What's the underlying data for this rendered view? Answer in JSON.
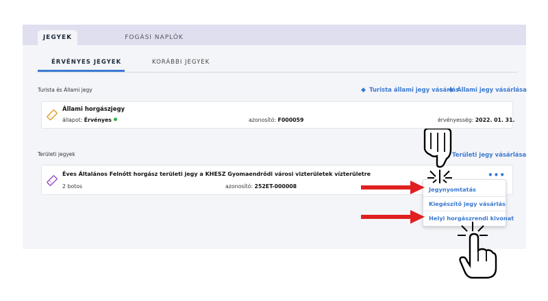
{
  "top_tabs": [
    "JEGYEK",
    "FOGÁSI NAPLÓK"
  ],
  "sub_tabs": [
    "ÉRVÉNYES JEGYEK",
    "KORÁBBI JEGYEK"
  ],
  "section1": {
    "label": "Turista és Állami jegy",
    "links": [
      "Turista állami jegy vásárlás",
      "Állami jegy vásárlása"
    ]
  },
  "card1": {
    "title": "Állami horgászjegy",
    "status_label": "állapot:",
    "status_value": "Érvényes",
    "id_label": "azonosító:",
    "id_value": "F000059",
    "valid_label": "érvényesség:",
    "valid_value": "2022. 01. 31."
  },
  "section2": {
    "label": "Területi jegyek",
    "link": "Területi jegy vásárlása"
  },
  "card2": {
    "title": "Éves Általános Felnőtt horgász területi jegy a KHESZ Gyomaendrődi városi vizterületek vízterületre",
    "sub": "2 botos",
    "id_label": "azonosító:",
    "id_value": "252ET-000008",
    "more": "•••"
  },
  "dropdown": [
    "Jegynyomtatás",
    "Kiegészítő jegy vásárlás",
    "Helyi horgászrendi kivonat"
  ],
  "colors": {
    "accent": "#3b7ad1",
    "arrow": "#e02020",
    "valid_dot": "#2eb04a",
    "ticket_gold": "#e0a431",
    "ticket_purple": "#9b59c6"
  }
}
